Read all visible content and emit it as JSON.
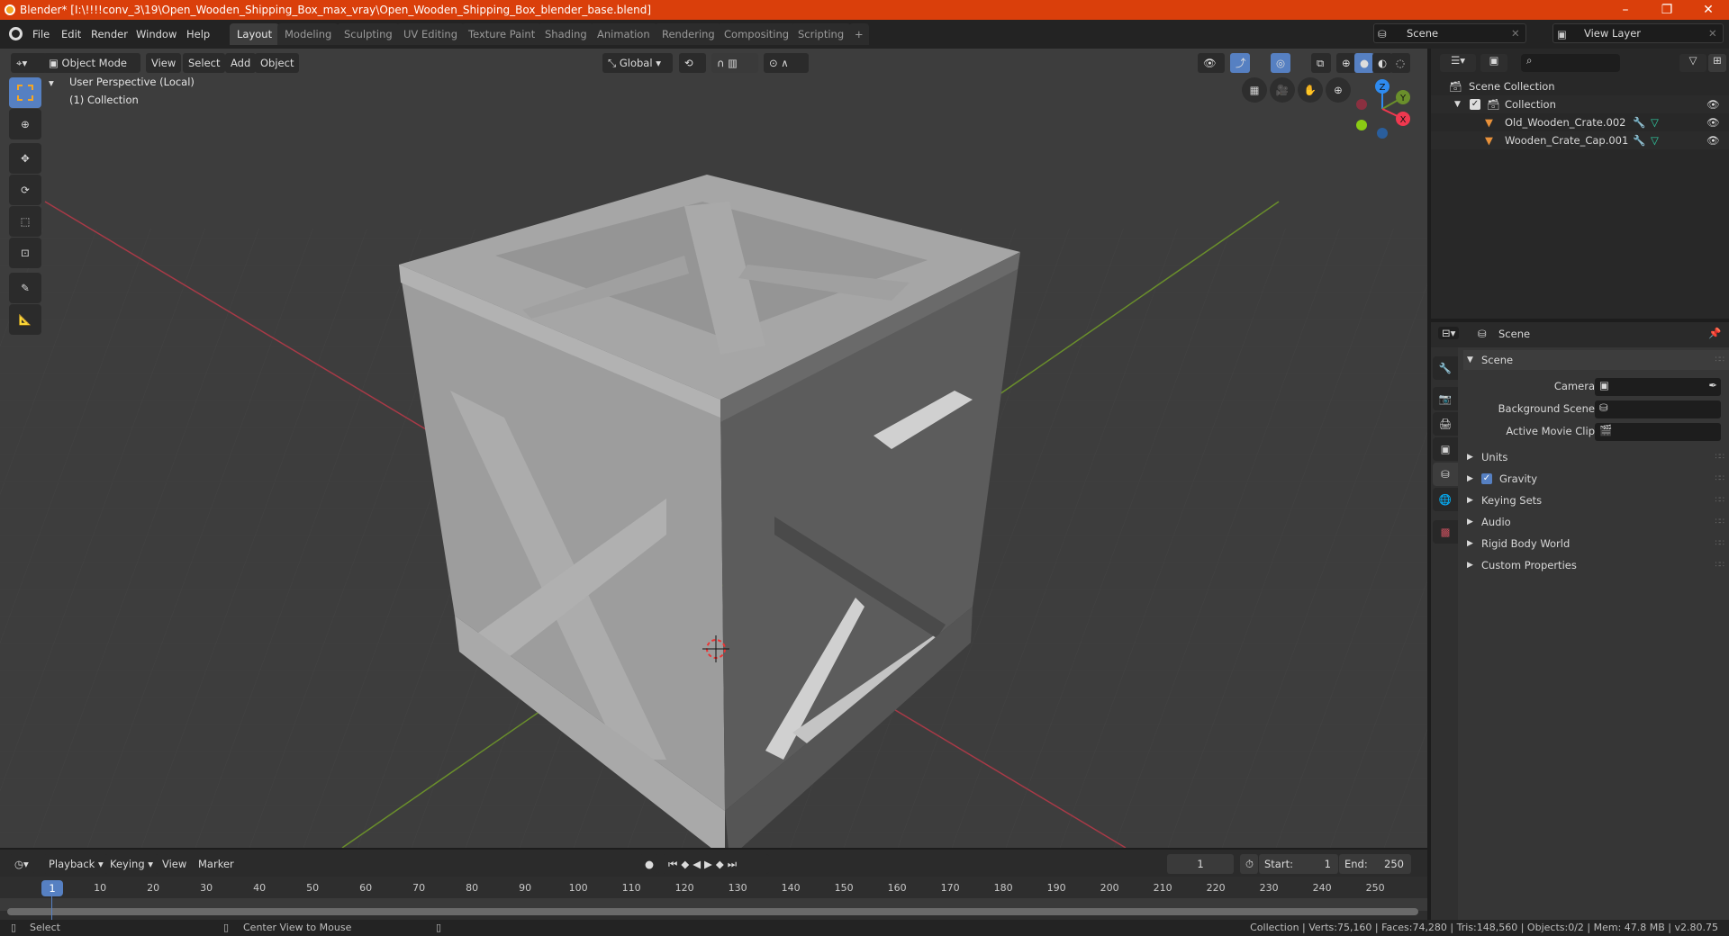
{
  "window": {
    "title": "Blender* [I:\\!!!!conv_3\\19\\Open_Wooden_Shipping_Box_max_vray\\Open_Wooden_Shipping_Box_blender_base.blend]",
    "minimize": "–",
    "maximize": "❐",
    "close": "✕"
  },
  "menus": [
    "File",
    "Edit",
    "Render",
    "Window",
    "Help"
  ],
  "workspaces": [
    "Layout",
    "Modeling",
    "Sculpting",
    "UV Editing",
    "Texture Paint",
    "Shading",
    "Animation",
    "Rendering",
    "Compositing",
    "Scripting"
  ],
  "add_workspace": "+",
  "scene_selector": {
    "value": "Scene"
  },
  "view_layer_selector": {
    "value": "View Layer"
  },
  "viewport": {
    "mode": "Object Mode",
    "menus": [
      "View",
      "Select",
      "Add",
      "Object"
    ],
    "transform_orientation": "Global",
    "overlay_line1": "User Perspective (Local)",
    "overlay_line2": "(1) Collection",
    "gizmo": {
      "x": "X",
      "y": "Y",
      "z": "Z",
      "x_color": "#f0384f",
      "y_color": "#6a8f2b",
      "z_color": "#2e8bf0"
    }
  },
  "outliner": {
    "root": "Scene Collection",
    "collection": "Collection",
    "objects": [
      {
        "name": "Old_Wooden_Crate.002"
      },
      {
        "name": "Wooden_Crate_Cap.001"
      }
    ]
  },
  "properties": {
    "header": "Scene",
    "section": "Scene",
    "fields": [
      {
        "label": "Camera"
      },
      {
        "label": "Background Scene"
      },
      {
        "label": "Active Movie Clip"
      }
    ],
    "panels": [
      "Units",
      "Gravity",
      "Keying Sets",
      "Audio",
      "Rigid Body World",
      "Custom Properties"
    ],
    "gravity_checked": true
  },
  "timeline": {
    "menus": [
      "Playback",
      "Keying",
      "View",
      "Marker"
    ],
    "current_frame": "1",
    "start_label": "Start:",
    "start": "1",
    "end_label": "End:",
    "end": "250",
    "ticks": [
      "10",
      "20",
      "30",
      "40",
      "50",
      "60",
      "70",
      "80",
      "90",
      "100",
      "110",
      "120",
      "130",
      "140",
      "150",
      "160",
      "170",
      "180",
      "190",
      "200",
      "210",
      "220",
      "230",
      "240",
      "250"
    ],
    "playhead": "1"
  },
  "statusbar": {
    "left_action": "Select",
    "middle_action": "Center View to Mouse",
    "stats": "Collection | Verts:75,160 | Faces:74,280 | Tris:148,560 | Objects:0/2 | Mem: 47.8 MB | v2.80.75"
  }
}
